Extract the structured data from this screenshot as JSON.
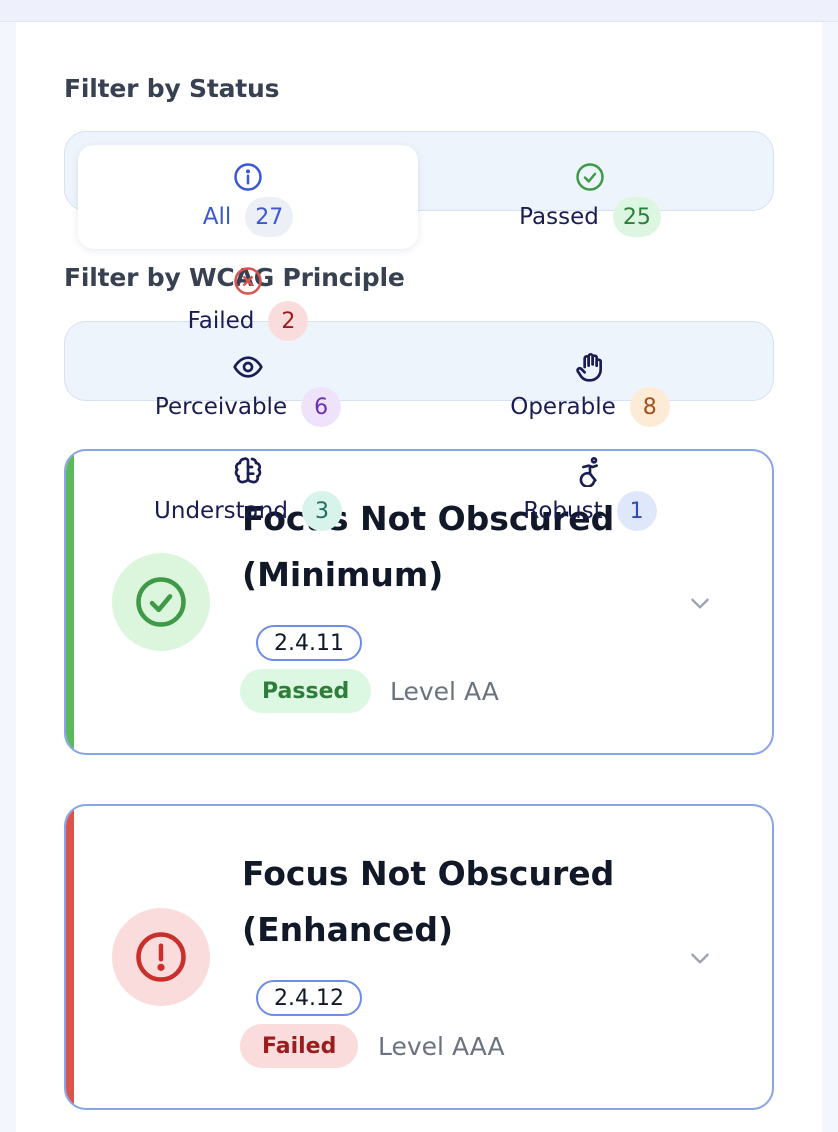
{
  "status_filter": {
    "heading": "Filter by Status",
    "options": [
      {
        "label": "All",
        "count": "27",
        "icon": "info-icon",
        "selected": true
      },
      {
        "label": "Passed",
        "count": "25",
        "icon": "check-circle-icon",
        "selected": false
      },
      {
        "label": "Failed",
        "count": "2",
        "icon": "x-circle-icon",
        "selected": false
      }
    ]
  },
  "principle_filter": {
    "heading": "Filter by WCAG Principle",
    "options": [
      {
        "label": "Perceivable",
        "count": "6",
        "icon": "eye-icon"
      },
      {
        "label": "Operable",
        "count": "8",
        "icon": "hand-icon"
      },
      {
        "label": "Understand",
        "count": "3",
        "icon": "brain-icon"
      },
      {
        "label": "Robust",
        "count": "1",
        "icon": "accessibility-icon"
      }
    ]
  },
  "criteria": [
    {
      "title": "Focus Not Obscured (Minimum)",
      "code": "2.4.11",
      "status": "Passed",
      "level": "Level AA",
      "icon": "check-circle-icon"
    },
    {
      "title": "Focus Not Obscured (Enhanced)",
      "code": "2.4.12",
      "status": "Failed",
      "level": "Level AAA",
      "icon": "alert-circle-icon"
    }
  ],
  "colors": {
    "passed_accent": "#5cb85c",
    "failed_accent": "#d9534f",
    "card_border": "#8aa4e8",
    "selected_text": "#3a57d6"
  }
}
